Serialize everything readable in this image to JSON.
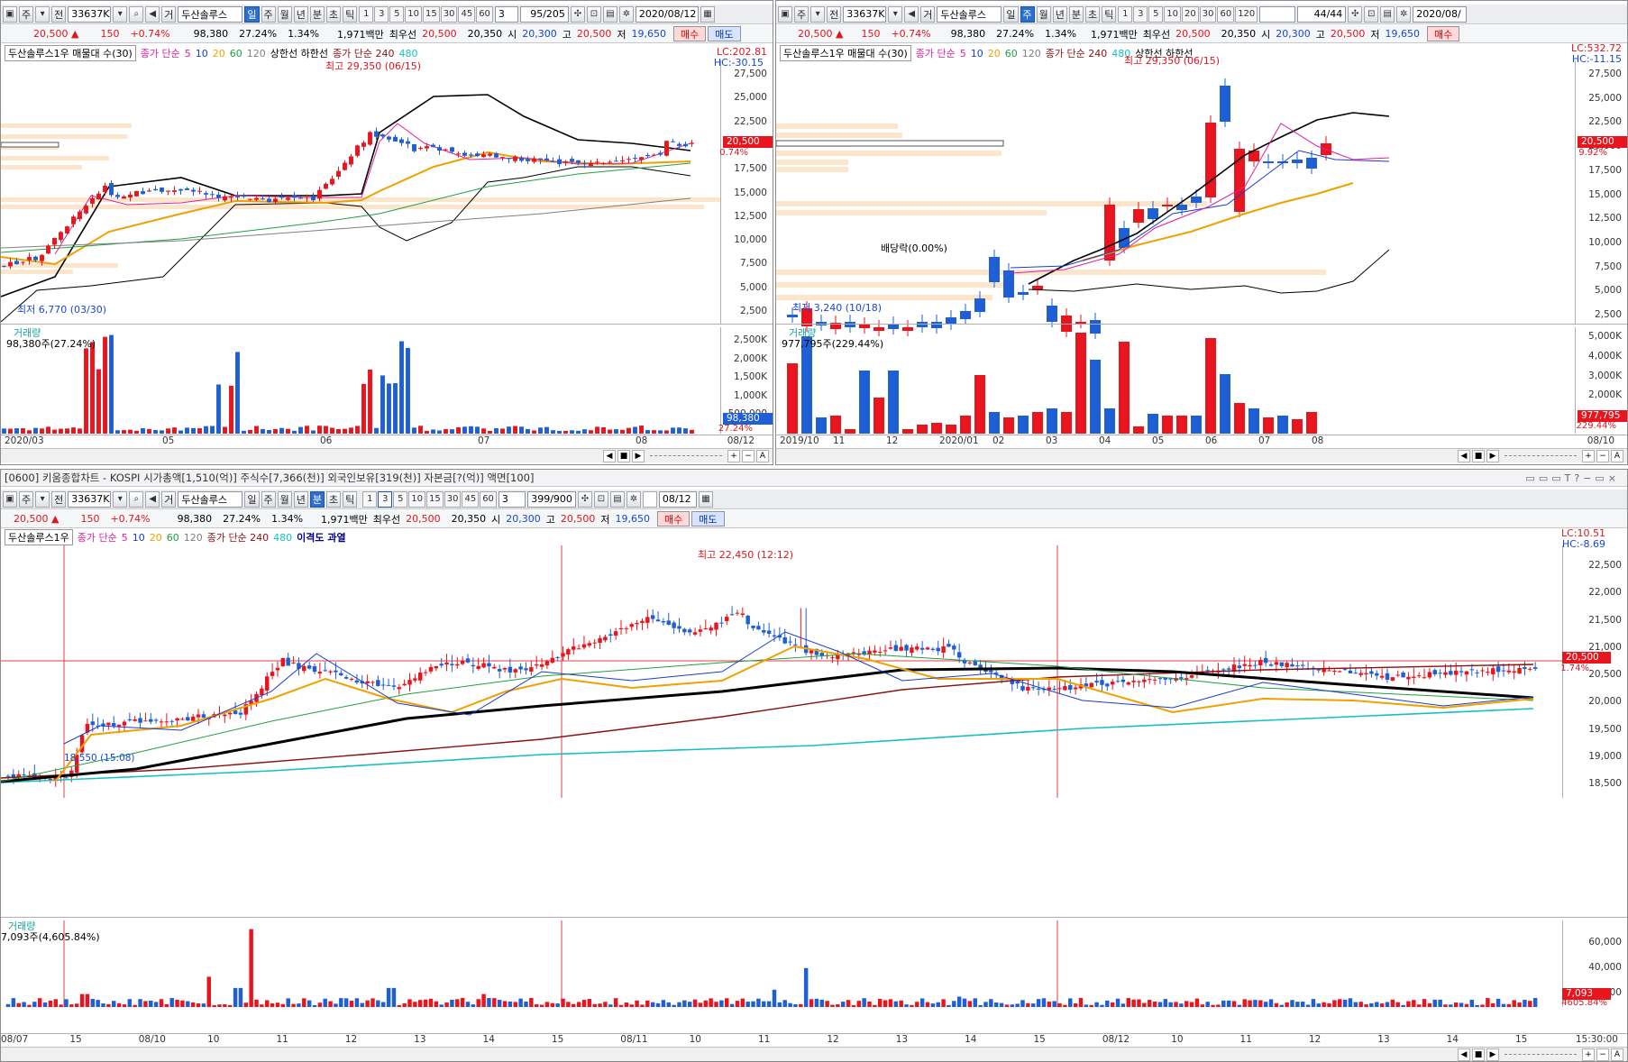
{
  "colors": {
    "up": "#e8141e",
    "down": "#1f5fd6",
    "ma5": "#e0209a",
    "ma10": "#1a3ccc",
    "ma20": "#f0a000",
    "ma60": "#20a040",
    "ma120": "#808080",
    "ma240": "#000000",
    "ma480": "#15c0c0"
  },
  "toolbar": {
    "market_btn": "주",
    "prefix_btn": "전",
    "code": "33637K",
    "trade_btn": "거",
    "stock_name": "두산솔루스",
    "period_day": "일",
    "period_week": "주",
    "period_month": "월",
    "period_year": "년",
    "period_min": "분",
    "period_sec": "초",
    "period_tick": "틱",
    "nums": [
      "1",
      "3",
      "5",
      "10",
      "15",
      "30",
      "45",
      "60"
    ],
    "nums_tl": [
      "1",
      "3",
      "5",
      "10",
      "15",
      "30",
      "45",
      "60"
    ],
    "nums_tr": [
      "1",
      "3",
      "5",
      "10",
      "20",
      "30",
      "60",
      "120"
    ],
    "interval_tl": "3",
    "interval_b": "3",
    "count_tl": "95/205",
    "count_tr": "44/44",
    "count_b": "399/900",
    "date_tl": "2020/08/12",
    "date_tr": "2020/08/",
    "date_b": "08/12"
  },
  "quote": {
    "price": "20,500",
    "arrow": "▲",
    "change": "150",
    "change_pct": "+0.74%",
    "volume": "98,380",
    "turnover_pct": "27.24%",
    "ratio": "1.34%",
    "amount": "1,971백만",
    "pref_label": "최우선",
    "best_ask": "20,500",
    "best_bid": "20,350",
    "open_label": "시",
    "open": "20,300",
    "high_label": "고",
    "high": "20,500",
    "low_label": "저",
    "low": "19,650",
    "buy_btn": "매수",
    "sell_btn": "매도"
  },
  "panel_tl": {
    "legend_name": "두산솔루스1우 매물대 수(30)",
    "legend_ma": "종가 단순",
    "ma_periods": [
      "5",
      "10",
      "20",
      "60",
      "120"
    ],
    "legend_bb": "상한선 하한선",
    "legend_ma2": "종가 단순 240",
    "ma_480": "480",
    "lc": "LC:202.81",
    "hc": "HC:-30.15",
    "y_labels": [
      "27,500",
      "25,000",
      "22,500",
      "20,000",
      "17,500",
      "15,000",
      "12,500",
      "10,000",
      "7,500",
      "5,000",
      "2,500"
    ],
    "price_tag": "20,500",
    "price_tag_pct": "0.74%",
    "high_note": "최고 29,350 (06/15)",
    "low_note": "최저 6,770 (03/30)",
    "vol_title": "거래량",
    "vol_value": "98,380주(27.24%)",
    "vol_labels": [
      "2,500K",
      "2,000K",
      "1,500K",
      "1,000K",
      "500,000"
    ],
    "vol_tag": "98,380",
    "vol_tag_pct": "27.24%",
    "x_labels": [
      "2020/03",
      "05",
      "06",
      "07",
      "08"
    ],
    "x_last": "08/12"
  },
  "panel_tr": {
    "legend_name": "두산솔루스1우 매물대 수(30)",
    "legend_ma": "종가 단순",
    "ma_periods": [
      "5",
      "10",
      "20",
      "60",
      "120"
    ],
    "legend_ma2": "종가 단순 240",
    "ma_480": "480",
    "legend_bb": "상한선 하한선",
    "lc": "LC:532.72",
    "hc": "HC:-11.15",
    "y_labels": [
      "27,500",
      "25,000",
      "22,500",
      "20,000",
      "17,500",
      "15,000",
      "12,500",
      "10,000",
      "7,500",
      "5,000",
      "2,500"
    ],
    "price_tag": "20,500",
    "price_tag_pct": "9.92%",
    "high_note": "최고 29,350 (06/15)",
    "low_note": "최저 3,240 (10/18)",
    "div_note": "배당락(0.00%)",
    "vol_title": "거래량",
    "vol_value": "977,795주(229.44%)",
    "vol_labels": [
      "5,000K",
      "4,000K",
      "3,000K",
      "2,000K",
      "1,000K"
    ],
    "vol_tag": "977,795",
    "vol_tag_pct": "229.44%",
    "x_labels": [
      "2019/10",
      "11",
      "12",
      "2020/01",
      "02",
      "03",
      "04",
      "05",
      "06",
      "07",
      "08"
    ],
    "x_last": "08/10"
  },
  "bottom": {
    "title": "[0600] 키움종합차트 - KOSPI 시가총액[1,510(억)] 주식수[7,366(천)] 외국인보유[319(천)] 자본금[?(억)] 액면[100]",
    "legend_name": "두산솔루스1우",
    "legend_ma": "종가 단순",
    "ma_periods": [
      "5",
      "10",
      "20",
      "60",
      "120"
    ],
    "legend_ma2": "종가 단순 240",
    "ma_480": "480",
    "disparity": "이격도 과열",
    "lc": "LC:10.51",
    "hc": "HC:-8.69",
    "y_labels": [
      "22,500",
      "22,000",
      "21,500",
      "21,000",
      "20,500",
      "20,000",
      "19,500",
      "19,000",
      "18,500"
    ],
    "price_tag": "20,500",
    "price_tag_pct": "1.74%",
    "high_note": "최고 22,450 (12:12)",
    "low_note": "18,550 (15:08)",
    "vol_title": "거래량",
    "vol_value": "7,093주(4,605.84%)",
    "vol_labels": [
      "60,000",
      "40,000",
      "20,000"
    ],
    "vol_tag": "7,093",
    "vol_tag_pct": "4605.84%",
    "x_labels": [
      "08/07",
      "15",
      "08/10",
      "10",
      "11",
      "12",
      "13",
      "14",
      "15",
      "08/11",
      "10",
      "11",
      "12",
      "13",
      "14",
      "15",
      "08/12",
      "10",
      "11",
      "12",
      "13",
      "14",
      "15"
    ],
    "x_last": "15:30:00"
  }
}
